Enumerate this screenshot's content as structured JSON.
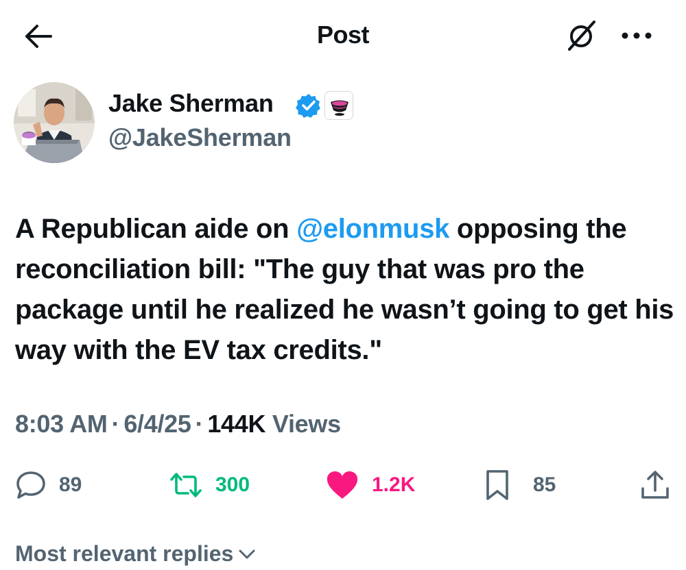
{
  "header": {
    "title": "Post"
  },
  "author": {
    "display_name": "Jake Sherman",
    "handle": "@JakeSherman"
  },
  "tweet": {
    "text_before": "A Republican aide on ",
    "mention": "@elonmusk",
    "text_after": " opposing the reconciliation bill: \"The guy that was pro the package until he realized he wasn’t going to get his way with the EV tax credits.\""
  },
  "meta": {
    "time": "8:03 AM",
    "date": "6/4/25",
    "views_count": "144K",
    "views_label": "Views"
  },
  "actions": {
    "replies": "89",
    "reposts": "300",
    "likes": "1.2K",
    "bookmarks": "85"
  },
  "replies_sort": {
    "label": "Most relevant replies"
  },
  "colors": {
    "accent": "#1d9bf0",
    "repost": "#00ba7c",
    "like": "#f91880",
    "secondary_text": "#536471",
    "primary_text": "#0f1419"
  }
}
